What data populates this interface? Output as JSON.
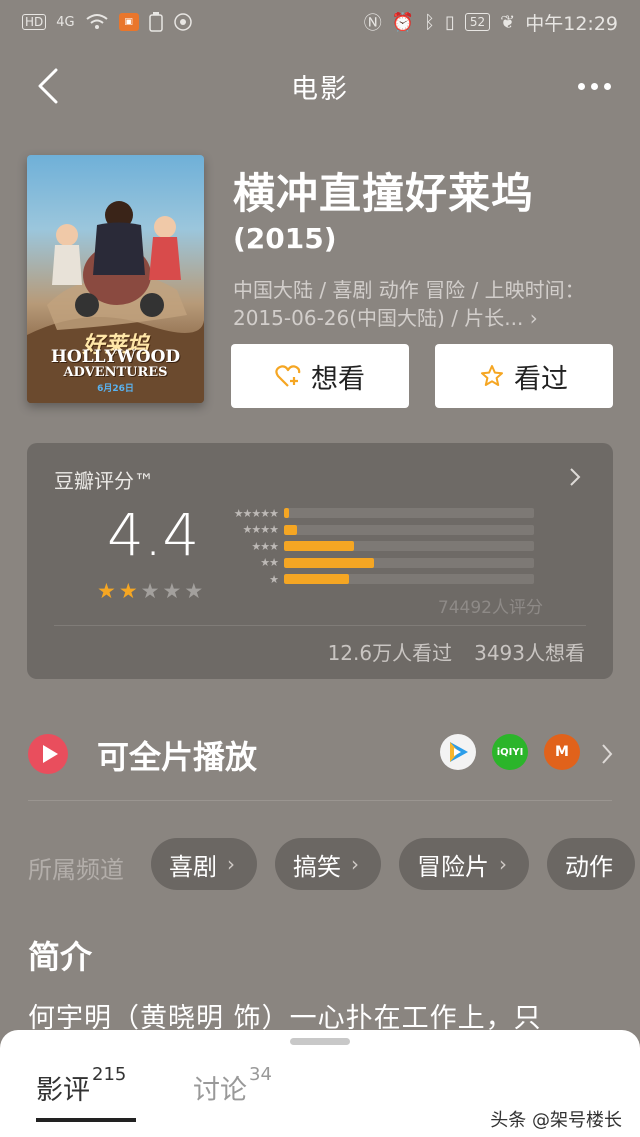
{
  "status_bar": {
    "hd": "HD",
    "signal": "4G",
    "battery": "52",
    "time": "中午12:29"
  },
  "nav": {
    "title": "电影"
  },
  "movie": {
    "title": "横冲直撞好莱坞",
    "year": "(2015)",
    "meta": "中国大陆 / 喜剧 动作 冒险 / 上映时间：2015-06-26(中国大陆) / 片长...",
    "poster": {
      "cn_title": "好莱坞",
      "en_line1": "HOLLYWOOD",
      "en_line2": "ADVENTURES",
      "date": "6月26日"
    }
  },
  "actions": {
    "want_label": "想看",
    "seen_label": "看过"
  },
  "rating": {
    "label": "豆瓣评分™",
    "score": "4.4",
    "stars_filled": 2,
    "stars_total": 5,
    "distribution": [
      {
        "stars": "★★★★★",
        "fraction": 0.02
      },
      {
        "stars": "★★★★",
        "fraction": 0.05
      },
      {
        "stars": "★★★",
        "fraction": 0.28
      },
      {
        "stars": "★★",
        "fraction": 0.36
      },
      {
        "stars": "★",
        "fraction": 0.26
      }
    ],
    "count": "74492人评分",
    "watched": "12.6万人看过",
    "want": "3493人想看"
  },
  "play": {
    "label": "可全片播放",
    "platforms": [
      "tencent-video-icon",
      "iqiyi-icon",
      "mgtv-icon"
    ],
    "iqiyi_text": "iQIYI",
    "mgtv_text": "M"
  },
  "channels": {
    "label": "所属频道",
    "items": [
      "喜剧",
      "搞笑",
      "冒险片",
      "动作"
    ]
  },
  "intro": {
    "title": "简介",
    "text": "何宇明（黄晓明 饰）一心扑在工作上，只"
  },
  "tabs": [
    {
      "label": "影评",
      "count": "215"
    },
    {
      "label": "讨论",
      "count": "34"
    }
  ],
  "watermark": "头条 @架号楼长",
  "colors": {
    "accent_star": "#f5a623",
    "play_red": "#e94e5d"
  }
}
